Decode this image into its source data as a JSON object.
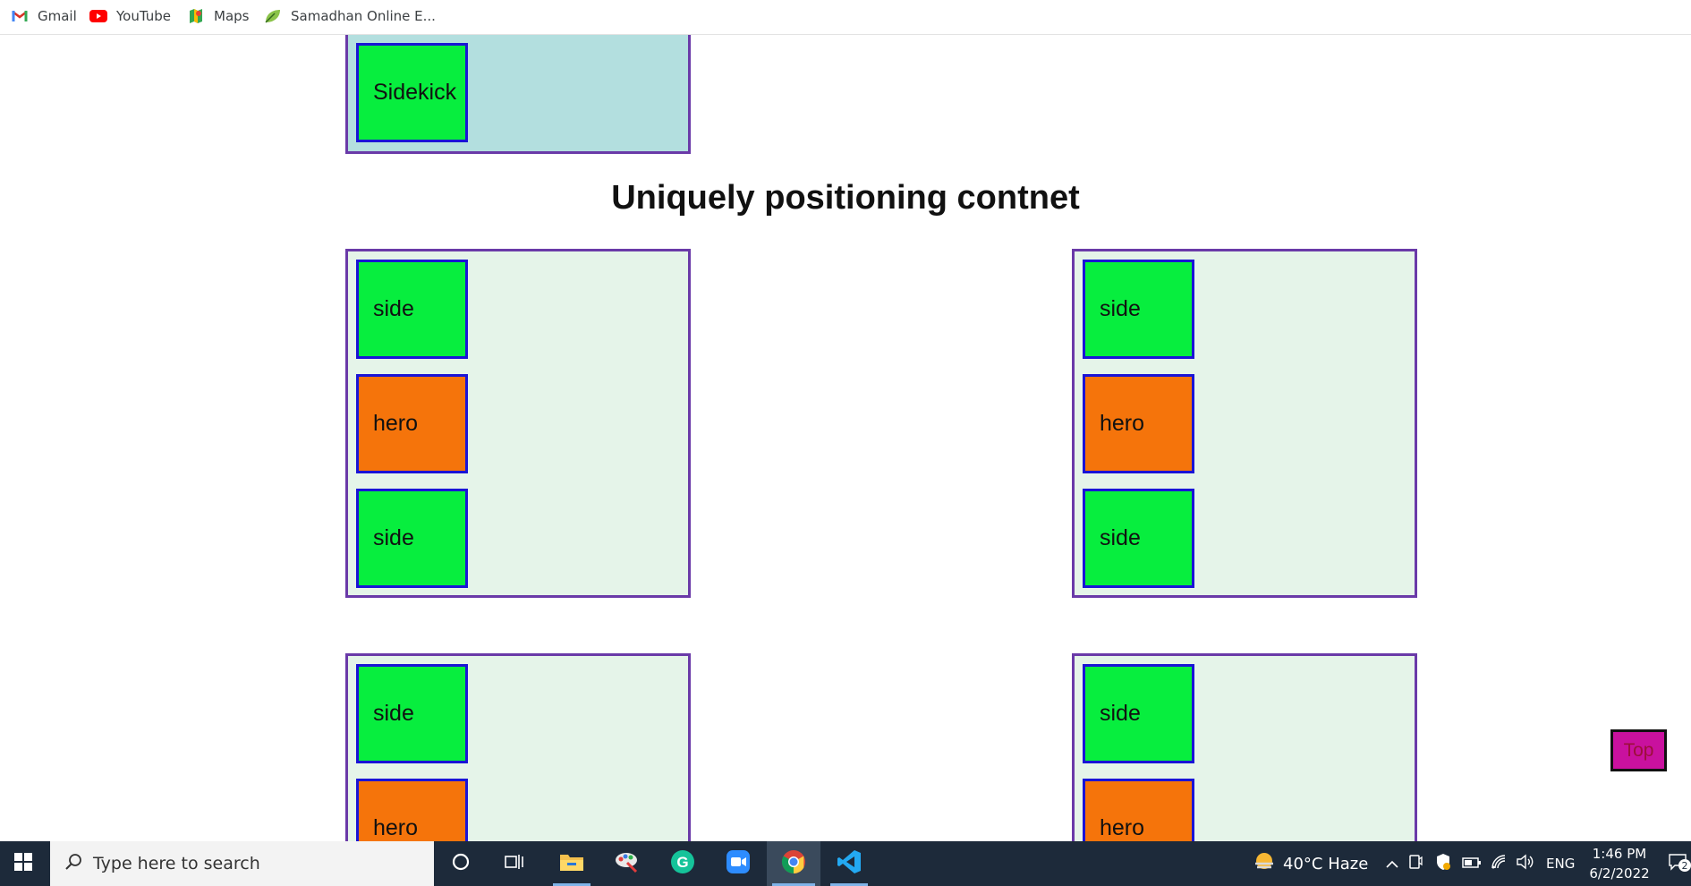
{
  "bookmarks": [
    {
      "label": "Gmail",
      "icon": "gmail-icon"
    },
    {
      "label": "YouTube",
      "icon": "youtube-icon"
    },
    {
      "label": "Maps",
      "icon": "maps-icon"
    },
    {
      "label": "Samadhan Online E...",
      "icon": "leaf-icon"
    }
  ],
  "page": {
    "top_sidekick": "Sidekick",
    "heading": "Uniquely positioning contnet",
    "row1": {
      "left": [
        "side",
        "hero",
        "side"
      ],
      "right": [
        "side",
        "hero",
        "side"
      ]
    },
    "row2": {
      "left": [
        "side",
        "hero"
      ],
      "right": [
        "side",
        "hero"
      ]
    },
    "top_button": "Top"
  },
  "colors": {
    "container_border": "#6a3aa8",
    "box_border": "#1a14d6",
    "green": "#07ee3e",
    "orange": "#f5740b",
    "cyan_bg": "#b3dfdf",
    "mint_bg": "#e5f4e9",
    "top_button_bg": "#c9119e"
  },
  "taskbar": {
    "search_placeholder": "Type here to search",
    "apps": [
      "task-view-icon",
      "file-explorer-icon",
      "paint-icon",
      "grammarly-icon",
      "zoom-icon",
      "chrome-icon",
      "vscode-icon"
    ],
    "weather": "40°C  Haze",
    "language": "ENG",
    "time": "1:46 PM",
    "date": "6/2/2022",
    "notification_count": "2"
  }
}
